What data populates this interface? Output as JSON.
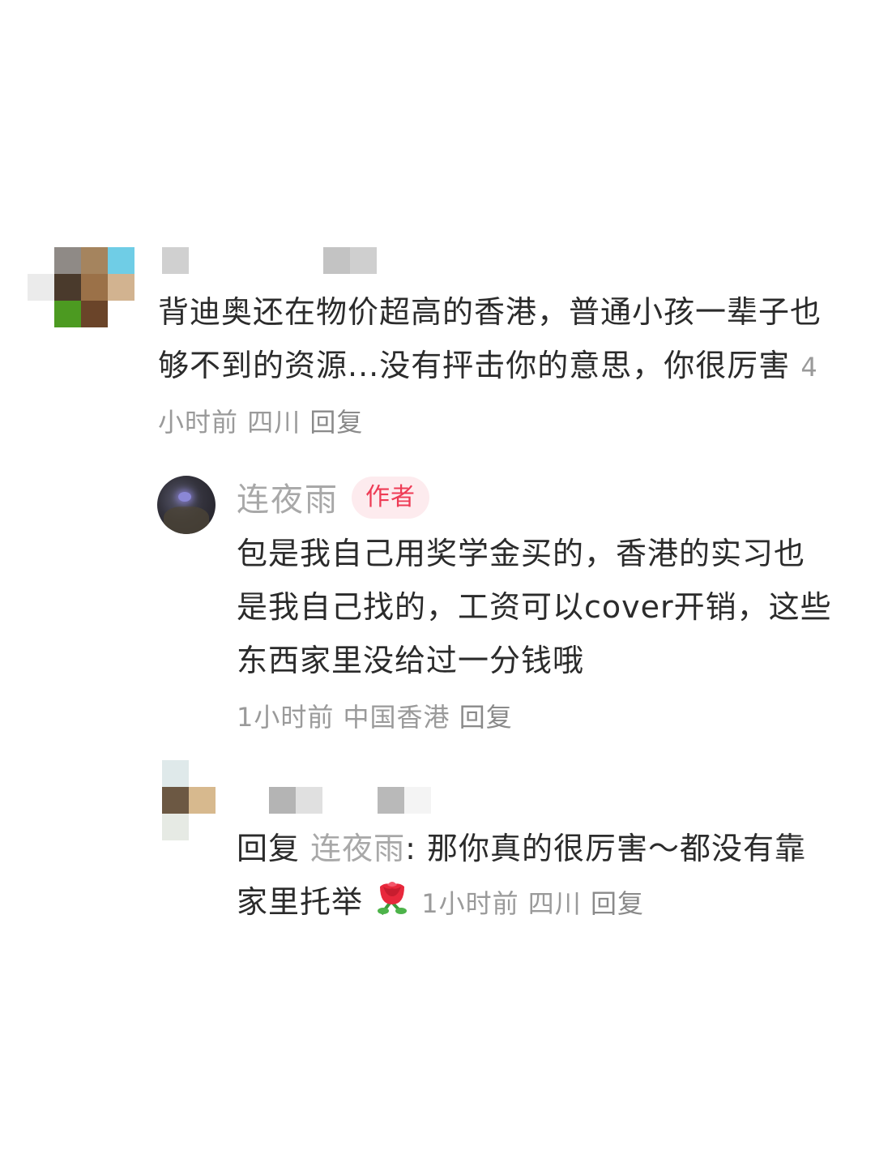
{
  "comments": [
    {
      "text": "背迪奥还在物价超高的香港，普通小孩一辈子也够不到的资源...没有抨击你的意思，你很厉害",
      "time": "4小时前",
      "location": "四川",
      "reply_label": "回复"
    },
    {
      "author": "连夜雨",
      "badge": "作者",
      "text": "包是我自己用奖学金买的，香港的实习也是我自己找的，工资可以cover开销，这些东西家里没给过一分钱哦",
      "time": "1小时前",
      "location": "中国香港",
      "reply_label": "回复"
    },
    {
      "reply_prefix": "回复",
      "mention": "连夜雨",
      "colon": ": ",
      "text": "那你真的很厉害～都没有靠家里托举",
      "emoji": "rose-emoji",
      "time": "1小时前",
      "location": "四川",
      "reply_label": "回复"
    }
  ],
  "colors": {
    "text": "#2b2b2b",
    "meta": "#9a9a9a",
    "author_name": "#a8a8a8",
    "badge_bg": "#fdebee",
    "badge_text": "#ee3b55"
  }
}
